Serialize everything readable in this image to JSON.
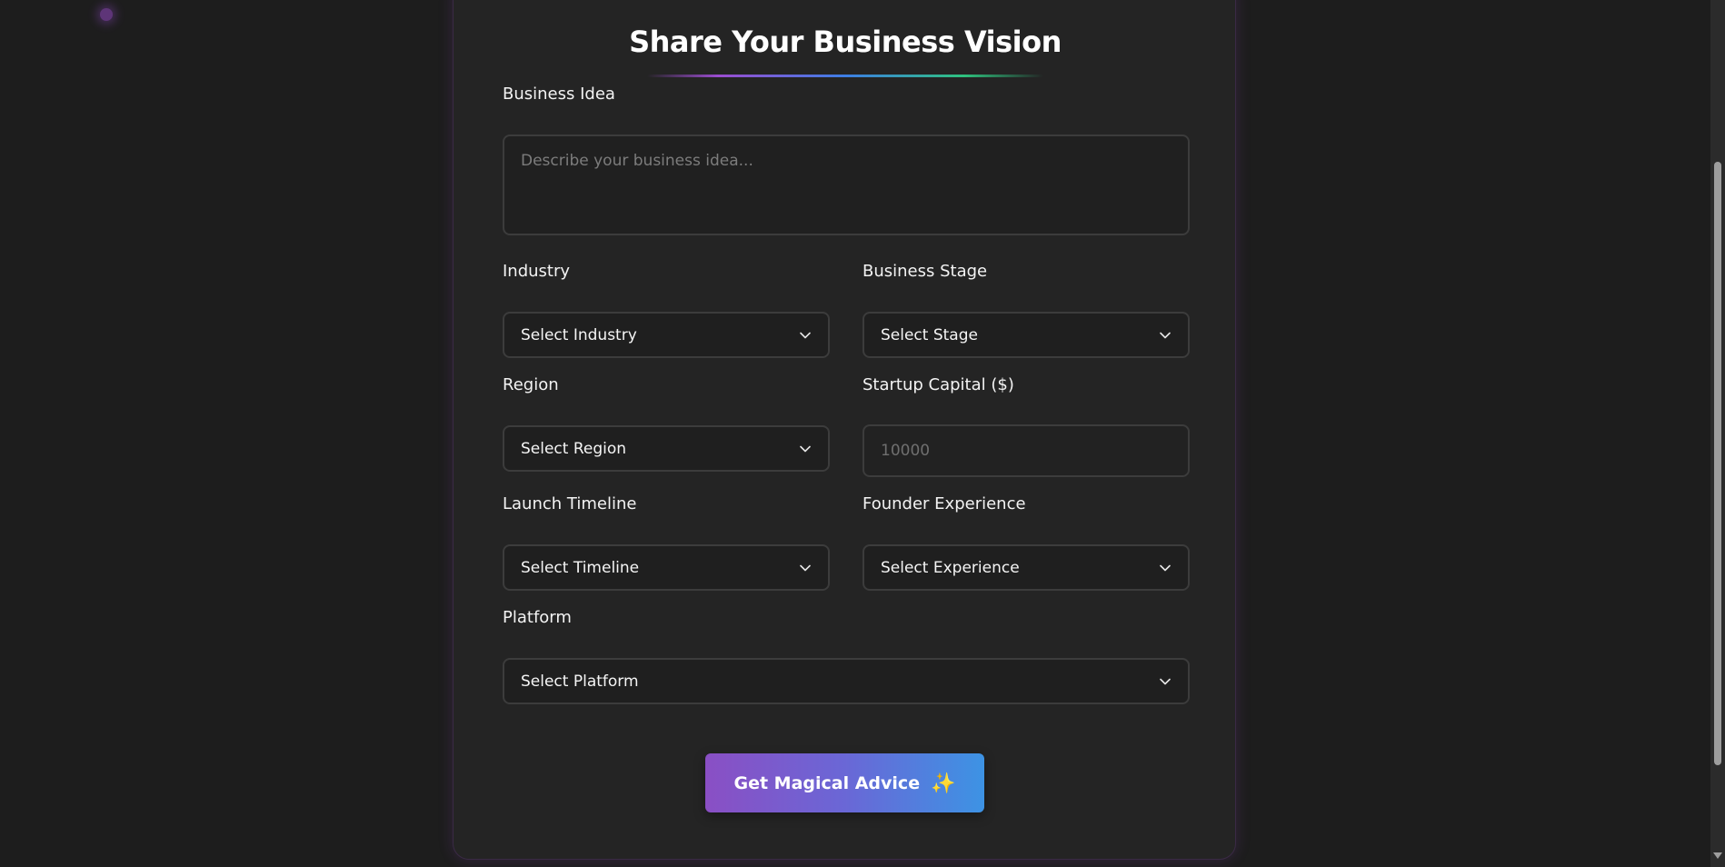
{
  "form": {
    "title": "Share Your Business Vision",
    "business_idea": {
      "label": "Business Idea",
      "placeholder": "Describe your business idea...",
      "value": ""
    },
    "industry": {
      "label": "Industry",
      "selected": "Select Industry"
    },
    "business_stage": {
      "label": "Business Stage",
      "selected": "Select Stage"
    },
    "region": {
      "label": "Region",
      "selected": "Select Region"
    },
    "startup_capital": {
      "label": "Startup Capital ($)",
      "placeholder": "10000",
      "value": ""
    },
    "launch_timeline": {
      "label": "Launch Timeline",
      "selected": "Select Timeline"
    },
    "founder_experience": {
      "label": "Founder Experience",
      "selected": "Select Experience"
    },
    "platform": {
      "label": "Platform",
      "selected": "Select Platform"
    },
    "submit": {
      "label": "Get Magical Advice",
      "icon": "sparkles-icon"
    }
  },
  "theme": {
    "background": "#1d1d1d",
    "card_background": "#242424",
    "accent_gradient": [
      "#8a4fc4",
      "#3d93e4"
    ],
    "underline_gradient": [
      "#9b4dd0",
      "#3d7ee6",
      "#2ec27e"
    ]
  },
  "icons": {
    "dropdown": "chevron-down-icon",
    "submit": "sparkles-icon"
  }
}
